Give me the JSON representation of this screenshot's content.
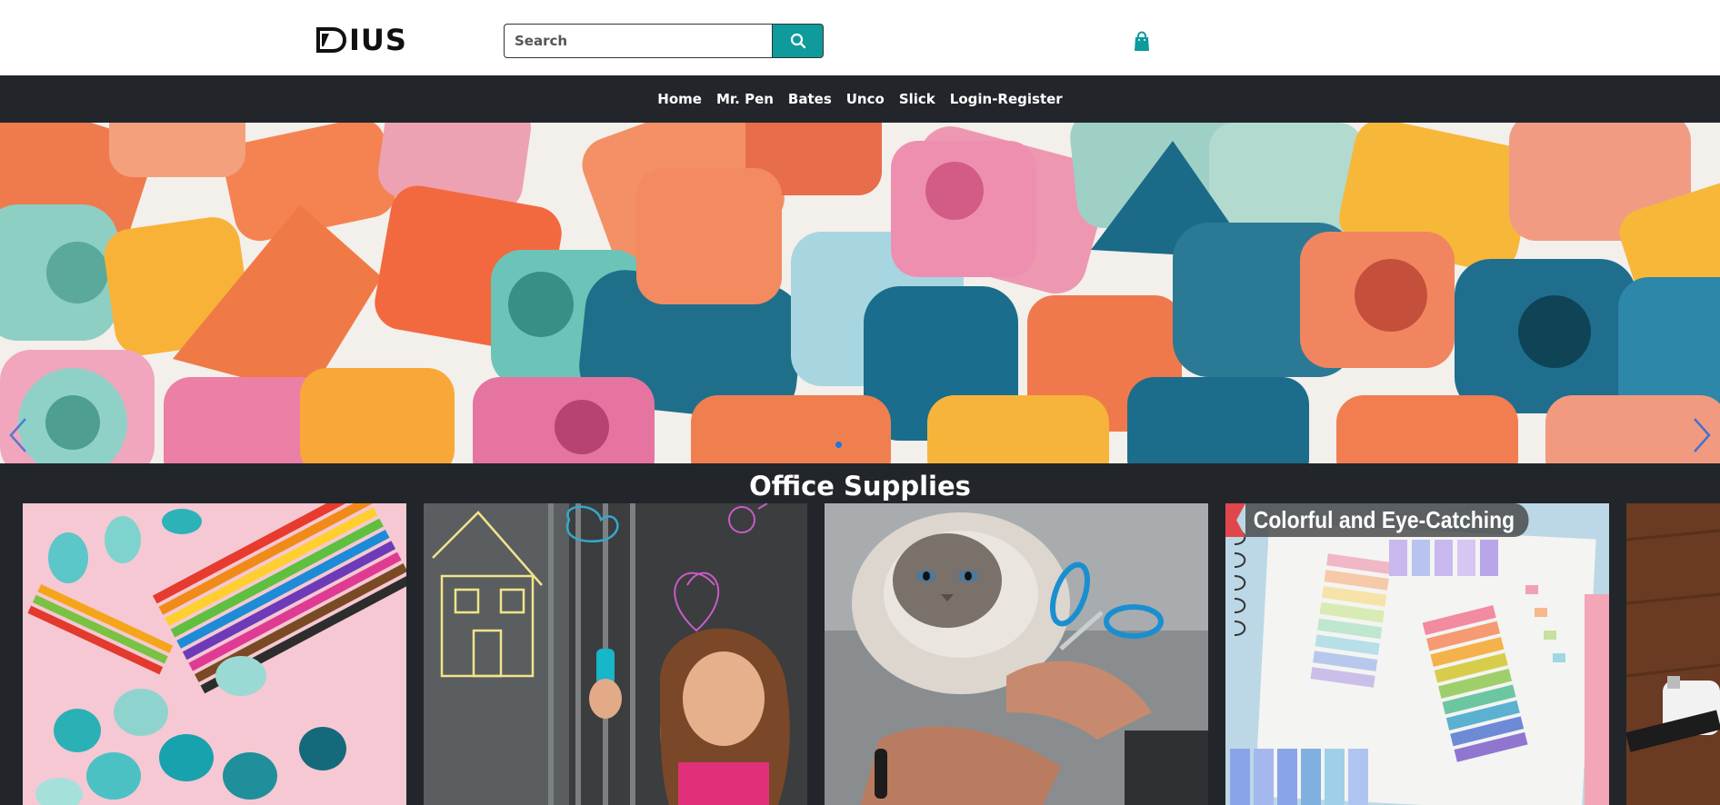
{
  "header": {
    "logo_text": "IUS",
    "search": {
      "placeholder": "Search",
      "value": ""
    },
    "icons": [
      "search-icon",
      "shopping-bag-icon"
    ],
    "accent_color": "#0f9a9c"
  },
  "nav": {
    "items": [
      {
        "label": "Home"
      },
      {
        "label": "Mr. Pen"
      },
      {
        "label": "Bates"
      },
      {
        "label": "Unco"
      },
      {
        "label": "Slick"
      },
      {
        "label": "Login-Register"
      }
    ]
  },
  "hero": {
    "subject": "pile of colorful pencil cap erasers",
    "slide_count": 1,
    "active_slide": 1,
    "icons": [
      "chevron-left-icon",
      "chevron-right-icon"
    ]
  },
  "section": {
    "title": "Office Supplies"
  },
  "cards": [
    {
      "subject": "pencil cap erasers and colored pencils"
    },
    {
      "subject": "child drawing on glass with marker"
    },
    {
      "subject": "cat with pet nail scissors"
    },
    {
      "subject": "colorful sticky tabs",
      "tag": "Colorful and Eye-Catching"
    },
    {
      "subject": "cable clips"
    }
  ],
  "colors": {
    "page_bg": "#22262b",
    "nav_bg": "#22262b",
    "dot_active": "#1877e8",
    "tag_flag": "#e0474c"
  }
}
